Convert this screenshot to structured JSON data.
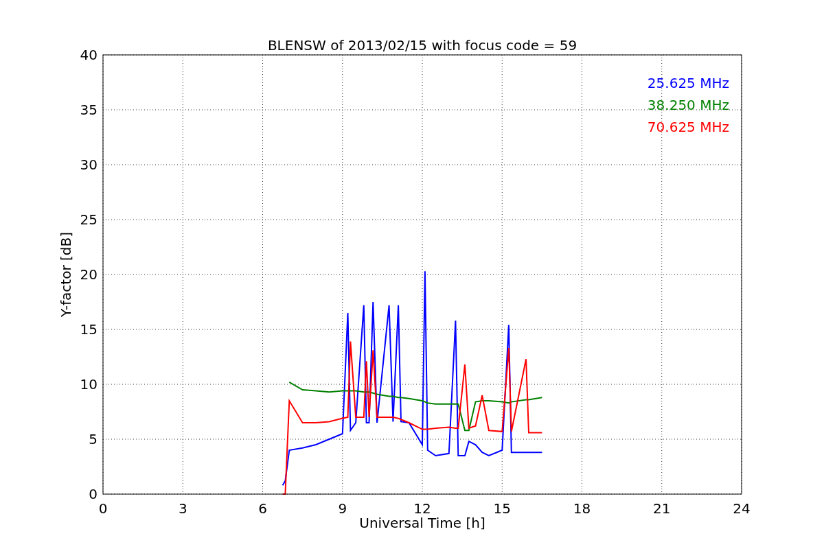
{
  "chart_data": {
    "type": "line",
    "title": "BLENSW of 2013/02/15 with focus code = 59",
    "xlabel": "Universal Time [h]",
    "ylabel": "Y-factor [dB]",
    "x": [
      6.75,
      6.85,
      7.0,
      7.5,
      8,
      8.5,
      9,
      9.2,
      9.3,
      9.5,
      9.8,
      9.9,
      10,
      10.15,
      10.3,
      10.75,
      10.9,
      11.1,
      11.2,
      11.5,
      12,
      12.1,
      12.2,
      12.5,
      13,
      13.25,
      13.35,
      13.6,
      13.75,
      14,
      14.25,
      14.5,
      15,
      15.25,
      15.35,
      15.9,
      16,
      16.5
    ],
    "series": [
      {
        "name": "25.625 MHz",
        "color": "#0000ff",
        "values": [
          0.8,
          1.2,
          4,
          4.2,
          4.5,
          5,
          5.5,
          16.5,
          5.8,
          6.5,
          17.2,
          6.5,
          6.5,
          17.5,
          6.5,
          17.2,
          6.6,
          17.2,
          6.6,
          6.5,
          4.5,
          20.3,
          4,
          3.5,
          3.7,
          15.8,
          3.5,
          3.5,
          4.8,
          4.5,
          3.8,
          3.5,
          4,
          15.4,
          3.8,
          3.8,
          3.8,
          3.8
        ]
      },
      {
        "name": "38.250 MHz",
        "color": "#008000",
        "values": [
          null,
          null,
          10.2,
          9.5,
          9.4,
          9.3,
          9.4,
          9.4,
          9.4,
          9.4,
          9.3,
          9.3,
          9.3,
          9.2,
          9.1,
          8.9,
          8.9,
          8.8,
          8.8,
          8.7,
          8.5,
          8.4,
          8.3,
          8.2,
          8.2,
          8.2,
          8.2,
          5.8,
          5.8,
          8.4,
          8.5,
          8.5,
          8.4,
          8.3,
          8.4,
          8.6,
          8.6,
          8.8
        ]
      },
      {
        "name": "70.625 MHz",
        "color": "#ff0000",
        "values": [
          0,
          0,
          8.5,
          6.5,
          6.5,
          6.6,
          6.9,
          7.0,
          13.9,
          7.0,
          7.0,
          12.1,
          7.0,
          13.1,
          7.0,
          7.0,
          7.0,
          6.9,
          6.8,
          6.5,
          5.9,
          5.9,
          5.9,
          6.0,
          6.1,
          6.0,
          6.0,
          11.8,
          6.0,
          6.2,
          9.0,
          5.8,
          5.7,
          13.3,
          5.7,
          12.3,
          5.6,
          5.6
        ]
      }
    ],
    "xlim": [
      0,
      24
    ],
    "ylim": [
      0,
      40
    ],
    "xticks": [
      0,
      3,
      6,
      9,
      12,
      15,
      18,
      21,
      24
    ],
    "yticks": [
      0,
      5,
      10,
      15,
      20,
      25,
      30,
      35,
      40
    ],
    "grid": true
  }
}
